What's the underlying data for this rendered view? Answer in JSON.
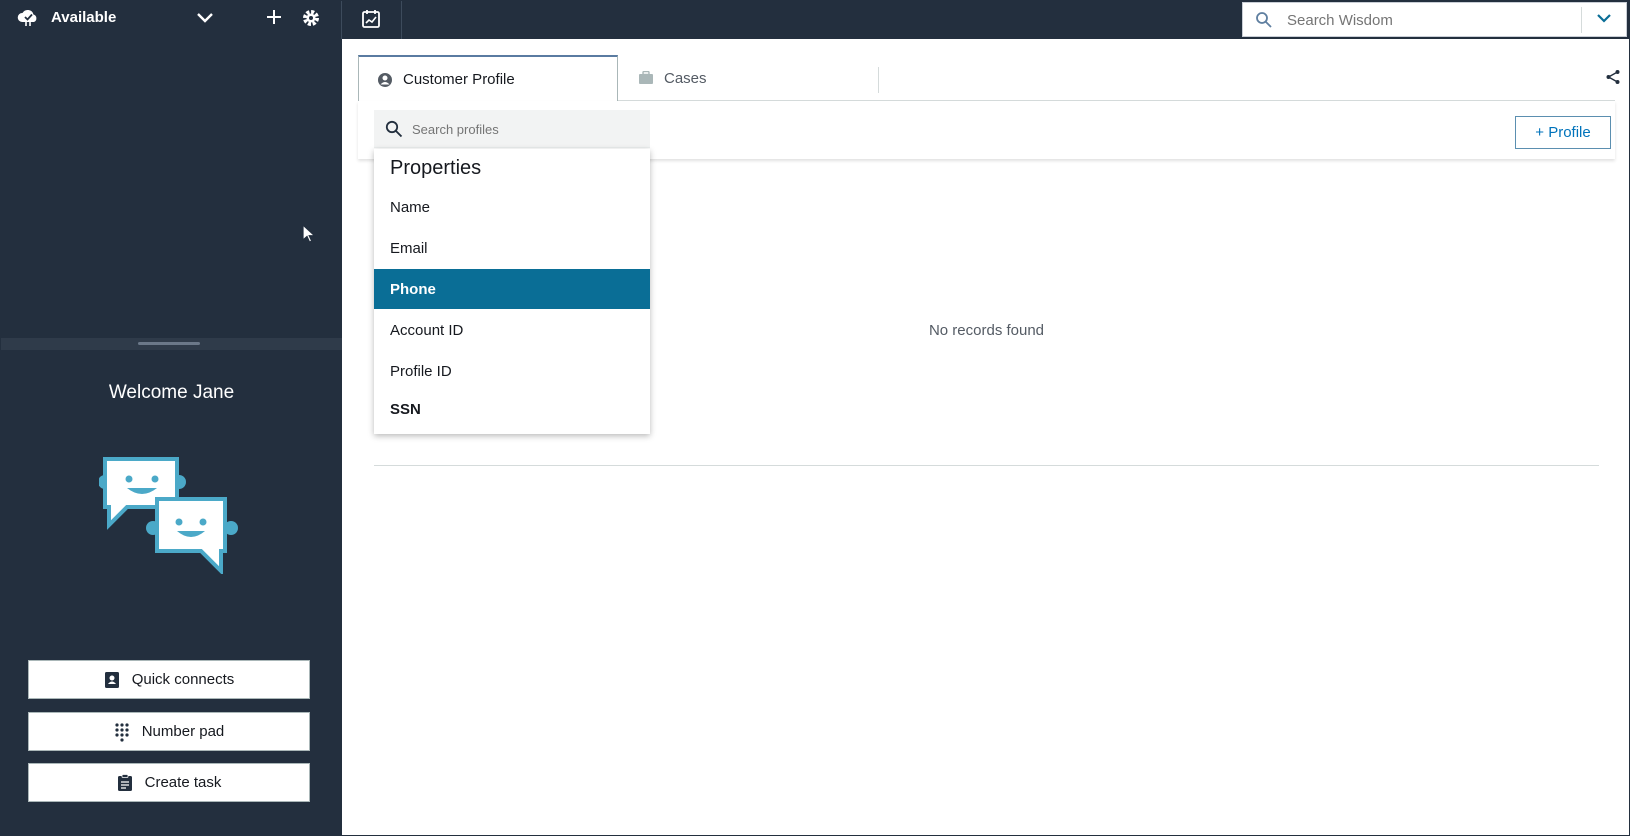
{
  "topbar": {
    "status_label": "Available",
    "status_icon": "cloud-icon",
    "search_placeholder": "Search Wisdom"
  },
  "left_panel": {
    "welcome_text": "Welcome Jane",
    "buttons": [
      {
        "label": "Quick connects",
        "icon": "contact-book-icon"
      },
      {
        "label": "Number pad",
        "icon": "dialpad-icon"
      },
      {
        "label": "Create task",
        "icon": "clipboard-icon"
      }
    ]
  },
  "tabs": [
    {
      "label": "Customer Profile",
      "icon": "user-circle-icon",
      "active": true
    },
    {
      "label": "Cases",
      "icon": "briefcase-icon",
      "active": false
    }
  ],
  "profile_search": {
    "placeholder": "Search profiles",
    "add_button_label": "+ Profile"
  },
  "dropdown": {
    "header": "Properties",
    "items": [
      {
        "label": "Name",
        "selected": false
      },
      {
        "label": "Email",
        "selected": false
      },
      {
        "label": "Phone",
        "selected": true
      },
      {
        "label": "Account ID",
        "selected": false
      },
      {
        "label": "Profile ID",
        "selected": false
      },
      {
        "label": "SSN",
        "selected": false
      }
    ]
  },
  "results": {
    "empty_text": "No records found"
  },
  "colors": {
    "nav_bg": "#232f3e",
    "selected_item_bg": "#0a6e96",
    "link_blue": "#0073bb",
    "bot_icon": "#4ba9c8"
  }
}
